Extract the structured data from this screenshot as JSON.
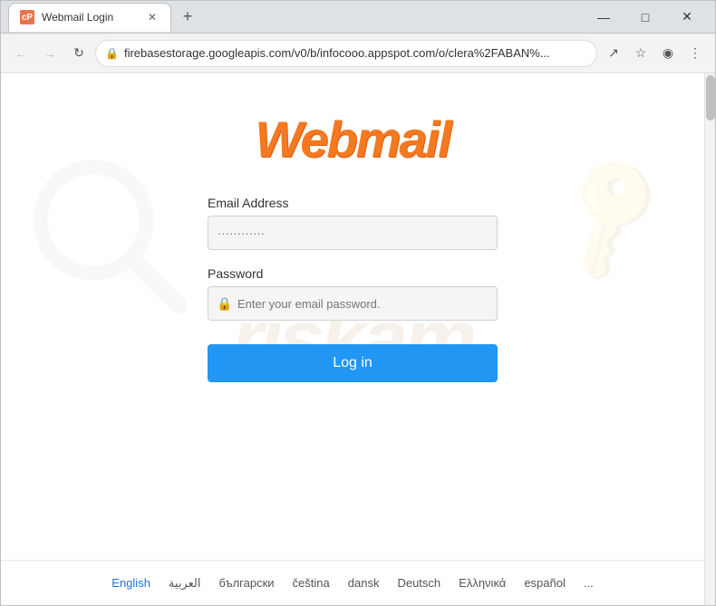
{
  "browser": {
    "title": "Webmail Login",
    "url": "firebasestorage.googleapis.com/v0/b/infocooo.appspot.com/o/clera%2FABAN%...",
    "tab_label": "Webmail Login",
    "tab_icon_text": "cP",
    "nav": {
      "back_label": "←",
      "forward_label": "→",
      "reload_label": "↻",
      "new_tab_label": "+",
      "min_label": "—",
      "max_label": "□",
      "close_label": "✕"
    },
    "address_actions": {
      "share": "↗",
      "bookmark": "☆",
      "profile": "◉",
      "menu": "⋮"
    }
  },
  "login": {
    "logo_text": "Webmail",
    "email_label": "Email Address",
    "email_placeholder": "············",
    "password_label": "Password",
    "password_placeholder": "Enter your email password.",
    "login_button": "Log in"
  },
  "languages": [
    {
      "code": "en",
      "label": "English",
      "active": true
    },
    {
      "code": "ar",
      "label": "العربية",
      "active": false
    },
    {
      "code": "bg",
      "label": "български",
      "active": false
    },
    {
      "code": "cs",
      "label": "čeština",
      "active": false
    },
    {
      "code": "da",
      "label": "dansk",
      "active": false
    },
    {
      "code": "de",
      "label": "Deutsch",
      "active": false
    },
    {
      "code": "el",
      "label": "Ελληνικά",
      "active": false
    },
    {
      "code": "es",
      "label": "español",
      "active": false
    },
    {
      "code": "more",
      "label": "...",
      "active": false
    }
  ],
  "watermark": {
    "text": "riskam"
  }
}
